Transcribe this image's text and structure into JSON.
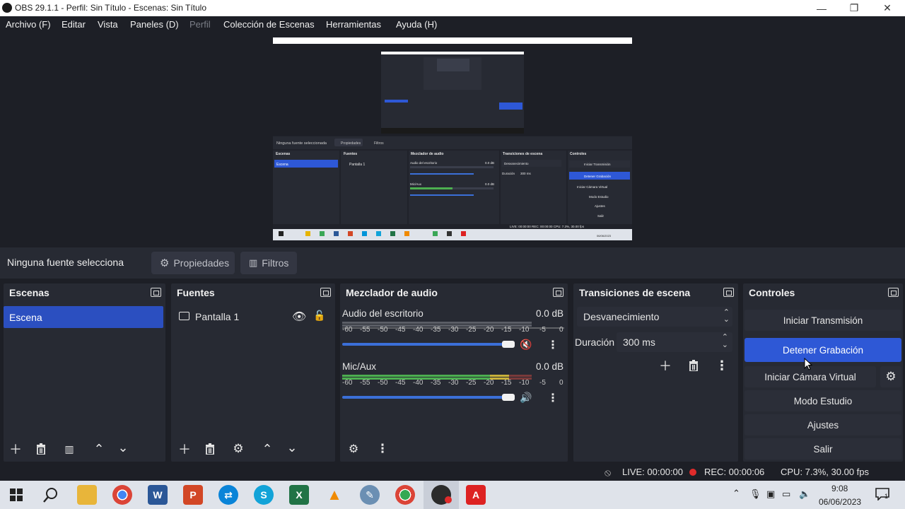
{
  "window": {
    "title": "OBS 29.1.1 - Perfil: Sin Título - Escenas: Sin Título",
    "minimize_glyph": "—",
    "maximize_glyph": "❐",
    "close_glyph": "✕"
  },
  "menu": {
    "items": [
      "Archivo (F)",
      "Editar",
      "Vista",
      "Paneles (D)",
      "Perfil",
      "Colección de Escenas",
      "Herramientas",
      "Ayuda (H)"
    ]
  },
  "source_bar": {
    "no_source_label": "Ninguna fuente selecciona",
    "properties_label": "Propiedades",
    "filters_label": "Filtros"
  },
  "scenes": {
    "title": "Escenas",
    "items": [
      "Escena"
    ]
  },
  "sources": {
    "title": "Fuentes",
    "items": [
      {
        "label": "Pantalla 1",
        "icon": "monitor-icon"
      }
    ]
  },
  "mixer": {
    "title": "Mezclador de audio",
    "channels": [
      {
        "name": "Audio del escritorio",
        "db": "0.0 dB",
        "muted": true,
        "volume_pct": 100
      },
      {
        "name": "Mic/Aux",
        "db": "0.0 dB",
        "muted": false,
        "volume_pct": 100
      }
    ],
    "scale": [
      "-60",
      "-55",
      "-50",
      "-45",
      "-40",
      "-35",
      "-30",
      "-25",
      "-20",
      "-15",
      "-10",
      "-5",
      "0"
    ]
  },
  "transitions": {
    "title": "Transiciones de escena",
    "selected": "Desvanecimiento",
    "duration_label": "Duración",
    "duration_value": "300 ms"
  },
  "controls": {
    "title": "Controles",
    "start_stream": "Iniciar Transmisión",
    "stop_recording": "Detener Grabación",
    "start_virtual_cam": "Iniciar Cámara Virtual",
    "studio_mode": "Modo Estudio",
    "settings": "Ajustes",
    "exit": "Salir"
  },
  "status": {
    "live": "LIVE: 00:00:00",
    "rec": "REC: 00:00:06",
    "cpu": "CPU: 7.3%, 30.00 fps"
  },
  "taskbar": {
    "time": "9:08",
    "date": "06/06/2023",
    "notification_count": "1"
  },
  "preview_thumb": {
    "no_source": "Ninguna fuente seleccionada",
    "props": "Propiedades",
    "filters": "Filtros",
    "docks": [
      "Escenas",
      "Fuentes",
      "Mezclador de audio",
      "Transiciones de escena",
      "Controles"
    ],
    "scene_item": "Escena",
    "source_item": "Pantalla 1",
    "mixer_ch1": "Audio del escritorio",
    "mixer_ch2": "Mic/Aux",
    "mixer_db": "0.0 dB",
    "fade": "Desvanecimiento",
    "duration_label": "Duración",
    "duration_value": "300 ms",
    "ctl": [
      "Iniciar Transmisión",
      "Detener Grabación",
      "Iniciar Cámara Virtual",
      "Modo Estudio",
      "Ajustes",
      "Salir"
    ],
    "status": "LIVE: 00:00:00   REC: 00:00:00   CPU: 7.3%, 30.00 fps",
    "clock": "06/06/2023"
  },
  "colors": {
    "accent": "#2e58d6",
    "panel": "#272a33",
    "background": "#1d1f26",
    "rec_dot": "#e02b2b",
    "muted_icon": "#c22a2a"
  }
}
